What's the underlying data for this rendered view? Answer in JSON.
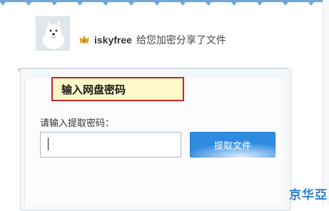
{
  "share": {
    "username": "iskyfree",
    "message": "给您加密分享了文件"
  },
  "callout": {
    "text": "输入网盘密码"
  },
  "form": {
    "label": "请输入提取密码：",
    "input_value": "",
    "button_label": "提取文件"
  },
  "watermark": {
    "text": "京华亞"
  },
  "colors": {
    "accent": "#2f8be0",
    "callout_border": "#c0292c",
    "callout_bg": "#fff9c9"
  }
}
